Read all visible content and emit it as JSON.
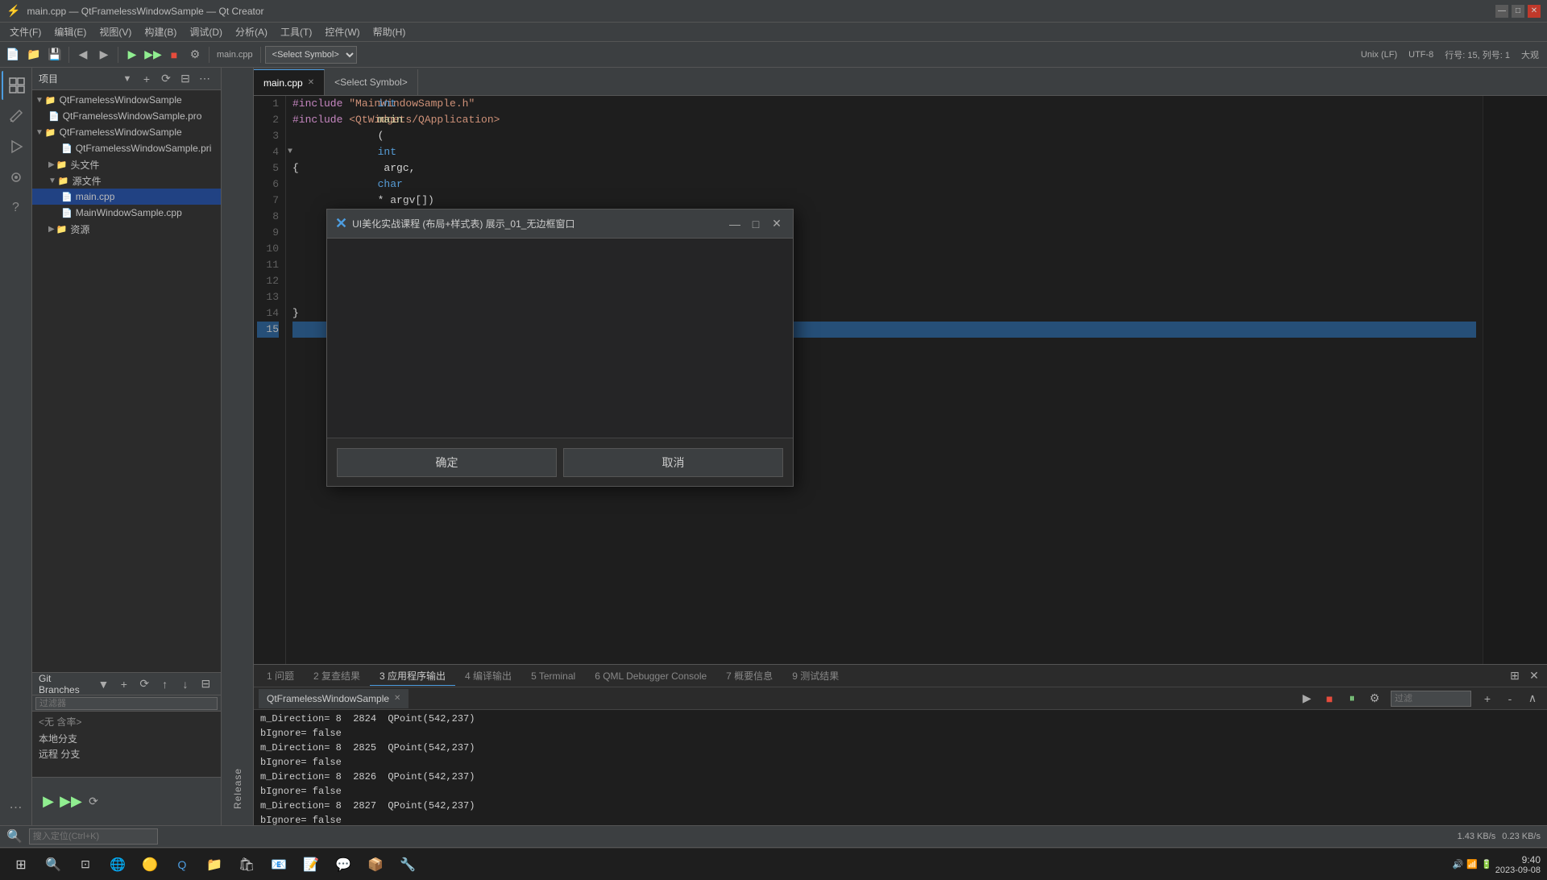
{
  "app": {
    "title": "main.cpp — QtFramelessWindowSample — Qt Creator",
    "version": "Qt Creator"
  },
  "titlebar": {
    "title": "main.cpp — QtFramelessWindowSample — Qt Creator",
    "minimize": "—",
    "restore": "□",
    "close": "✕"
  },
  "menubar": {
    "items": [
      {
        "label": "文件(F)"
      },
      {
        "label": "编辑(E)"
      },
      {
        "label": "视图(V)"
      },
      {
        "label": "构建(B)"
      },
      {
        "label": "调试(D)"
      },
      {
        "label": "分析(A)"
      },
      {
        "label": "工具(T)"
      },
      {
        "label": "控件(W)"
      },
      {
        "label": "帮助(H)"
      }
    ]
  },
  "toolbar": {
    "build_mode": "Release",
    "select_symbol_placeholder": "<Select Symbol>",
    "file_tab": "main.cpp",
    "encoding": "UTF-8",
    "line_ending": "Unix (LF)",
    "position": "行号: 15, 列号: 1",
    "zoom": "大观"
  },
  "project": {
    "header": "项目",
    "root": "QtFramelessWindowSample",
    "items": [
      {
        "label": "QtFramelessWindowSample.pro",
        "depth": 1,
        "icon": "📄"
      },
      {
        "label": "QtFramelessWindowSample",
        "depth": 1,
        "icon": "📁"
      },
      {
        "label": "QtFramelessWindowSample.pri",
        "depth": 2,
        "icon": "📄"
      },
      {
        "label": "头文件",
        "depth": 2,
        "icon": "📁"
      },
      {
        "label": "源文件",
        "depth": 2,
        "icon": "📁"
      },
      {
        "label": "main.cpp",
        "depth": 3,
        "icon": "📄",
        "selected": true
      },
      {
        "label": "MainWindowSample.cpp",
        "depth": 3,
        "icon": "📄"
      },
      {
        "label": "资源",
        "depth": 2,
        "icon": "📁"
      }
    ]
  },
  "git": {
    "header": "Git Branches",
    "filter_placeholder": "过滤器",
    "no_content": "< 无 含率>",
    "local_branch": "本地分支",
    "remote_branch": "远程 分支"
  },
  "release": {
    "label": "Release"
  },
  "editor": {
    "tabs": [
      {
        "label": "main.cpp",
        "active": true
      },
      {
        "label": "<Select Symbol>",
        "active": false
      }
    ],
    "code_lines": [
      {
        "num": 1,
        "content": "#include \"MainWindowSample.h\"",
        "type": "include"
      },
      {
        "num": 2,
        "content": "#include <QtWidgets/QApplication>",
        "type": "include"
      },
      {
        "num": 3,
        "content": "",
        "type": "normal"
      },
      {
        "num": 4,
        "content": "int main(int argc, char* argv[])",
        "type": "function"
      },
      {
        "num": 5,
        "content": "{",
        "type": "normal"
      },
      {
        "num": 6,
        "content": "",
        "type": "normal"
      },
      {
        "num": 7,
        "content": "",
        "type": "normal"
      },
      {
        "num": 8,
        "content": "",
        "type": "normal"
      },
      {
        "num": 9,
        "content": "",
        "type": "normal"
      },
      {
        "num": 10,
        "content": "",
        "type": "normal"
      },
      {
        "num": 11,
        "content": "",
        "type": "normal"
      },
      {
        "num": 12,
        "content": "",
        "type": "normal"
      },
      {
        "num": 13,
        "content": "",
        "type": "normal"
      },
      {
        "num": 14,
        "content": "}",
        "type": "normal"
      },
      {
        "num": 15,
        "content": "",
        "type": "highlighted"
      }
    ]
  },
  "dialog": {
    "title": "UI美化实战课程 (布局+样式表) 展示_01_无边框窗口",
    "confirm_label": "确定",
    "cancel_label": "取消"
  },
  "output": {
    "panel_title": "应用程序输出",
    "app_tab": "QtFramelessWindowSample",
    "filter_placeholder": "过滤",
    "lines": [
      "m_Direction= 8  2824  QPoint(542,237)",
      "bIgnore= false",
      "m_Direction= 8  2825  QPoint(542,237)",
      "bIgnore= false",
      "m_Direction= 8  2826  QPoint(542,237)",
      "bIgnore= false",
      "m_Direction= 8  2827  QPoint(542,237)",
      "bIgnore= false"
    ]
  },
  "bottom_tabs": [
    {
      "label": "1  问题",
      "num": 1
    },
    {
      "label": "2  复查结果",
      "num": 2
    },
    {
      "label": "3  应用程序输出",
      "num": 3
    },
    {
      "label": "4  编译输出",
      "num": 4
    },
    {
      "label": "5  Terminal",
      "num": 5
    },
    {
      "label": "6  QML Debugger Console",
      "num": 6
    },
    {
      "label": "7  概要信息",
      "num": 7
    },
    {
      "label": "9  测试结果",
      "num": 9
    }
  ],
  "statusbar": {
    "search_placeholder": "搜入定位(Ctrl+K)",
    "position": "1  问题",
    "encoding": "UTF-8",
    "line_ending": "Unix (LF)",
    "cursor": "行号: 15, 列号: 1",
    "zoom": "大观",
    "network_speed": "1.43 KB/s",
    "network_speed2": "0.23 KB/s",
    "time": "9:40",
    "date": "2023-09-08"
  }
}
